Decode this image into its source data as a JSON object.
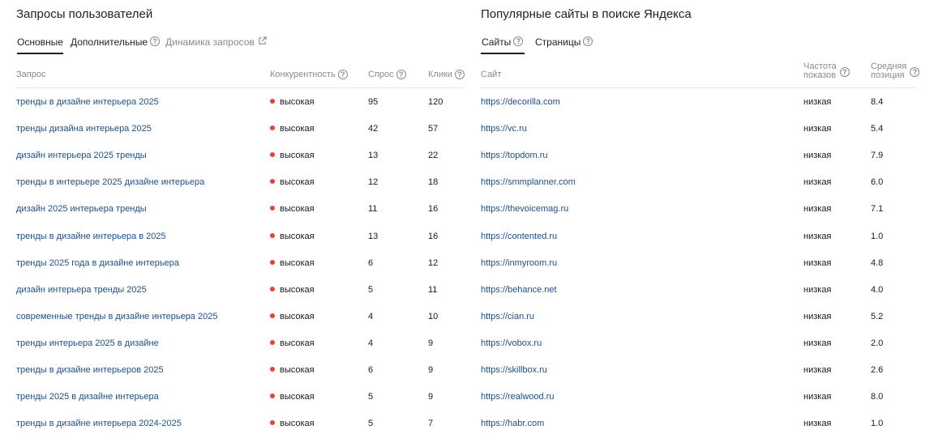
{
  "left": {
    "title": "Запросы пользователей",
    "tabs": [
      {
        "label": "Основные",
        "active": true,
        "icon": ""
      },
      {
        "label": "Дополнительные",
        "active": false,
        "icon": "help-icon"
      },
      {
        "label": "Динамика запросов",
        "active": false,
        "icon": "external-link-icon"
      }
    ],
    "columns": {
      "query": "Запрос",
      "competition": "Конкурентность",
      "demand": "Спрос",
      "clicks": "Клики"
    },
    "rows": [
      {
        "query": "тренды в дизайне интерьера 2025",
        "competition": "высокая",
        "demand": "95",
        "clicks": "120"
      },
      {
        "query": "тренды дизайна интерьера 2025",
        "competition": "высокая",
        "demand": "42",
        "clicks": "57"
      },
      {
        "query": "дизайн интерьера 2025 тренды",
        "competition": "высокая",
        "demand": "13",
        "clicks": "22"
      },
      {
        "query": "тренды в интерьере 2025 дизайне интерьера",
        "competition": "высокая",
        "demand": "12",
        "clicks": "18"
      },
      {
        "query": "дизайн 2025 интерьера тренды",
        "competition": "высокая",
        "demand": "11",
        "clicks": "16"
      },
      {
        "query": "тренды в дизайне интерьера в 2025",
        "competition": "высокая",
        "demand": "13",
        "clicks": "16"
      },
      {
        "query": "тренды 2025 года в дизайне интерьера",
        "competition": "высокая",
        "demand": "6",
        "clicks": "12"
      },
      {
        "query": "дизайн интерьера тренды 2025",
        "competition": "высокая",
        "demand": "5",
        "clicks": "11"
      },
      {
        "query": "современные тренды в дизайне интерьера 2025",
        "competition": "высокая",
        "demand": "4",
        "clicks": "10"
      },
      {
        "query": "тренды интерьера 2025 в дизайне",
        "competition": "высокая",
        "demand": "4",
        "clicks": "9"
      },
      {
        "query": "тренды в дизайне интерьеров 2025",
        "competition": "высокая",
        "demand": "6",
        "clicks": "9"
      },
      {
        "query": "тренды 2025 в дизайне интерьера",
        "competition": "высокая",
        "demand": "5",
        "clicks": "9"
      },
      {
        "query": "тренды в дизайне интерьера 2024-2025",
        "competition": "высокая",
        "demand": "5",
        "clicks": "7"
      }
    ]
  },
  "right": {
    "title": "Популярные сайты в поиске Яндекса",
    "tabs": [
      {
        "label": "Сайты",
        "active": true,
        "icon": "help-icon"
      },
      {
        "label": "Страницы",
        "active": false,
        "icon": "help-icon"
      }
    ],
    "columns": {
      "site": "Сайт",
      "frequency_1": "Частота",
      "frequency_2": "показов",
      "position_1": "Средняя",
      "position_2": "позиция"
    },
    "rows": [
      {
        "site": "https://decorilla.com",
        "frequency": "низкая",
        "position": "8.4"
      },
      {
        "site": "https://vc.ru",
        "frequency": "низкая",
        "position": "5.4"
      },
      {
        "site": "https://topdom.ru",
        "frequency": "низкая",
        "position": "7.9"
      },
      {
        "site": "https://smmplanner.com",
        "frequency": "низкая",
        "position": "6.0"
      },
      {
        "site": "https://thevoicemag.ru",
        "frequency": "низкая",
        "position": "7.1"
      },
      {
        "site": "https://contented.ru",
        "frequency": "низкая",
        "position": "1.0"
      },
      {
        "site": "https://inmyroom.ru",
        "frequency": "низкая",
        "position": "4.8"
      },
      {
        "site": "https://behance.net",
        "frequency": "низкая",
        "position": "4.0"
      },
      {
        "site": "https://cian.ru",
        "frequency": "низкая",
        "position": "5.2"
      },
      {
        "site": "https://vobox.ru",
        "frequency": "низкая",
        "position": "2.0"
      },
      {
        "site": "https://skillbox.ru",
        "frequency": "низкая",
        "position": "2.6"
      },
      {
        "site": "https://realwood.ru",
        "frequency": "низкая",
        "position": "8.0"
      },
      {
        "site": "https://habr.com",
        "frequency": "низкая",
        "position": "1.0"
      }
    ]
  },
  "colors": {
    "link": "#1d4f8a",
    "high_competition_dot": "#e8413a",
    "muted_text": "#8a8a8a"
  }
}
